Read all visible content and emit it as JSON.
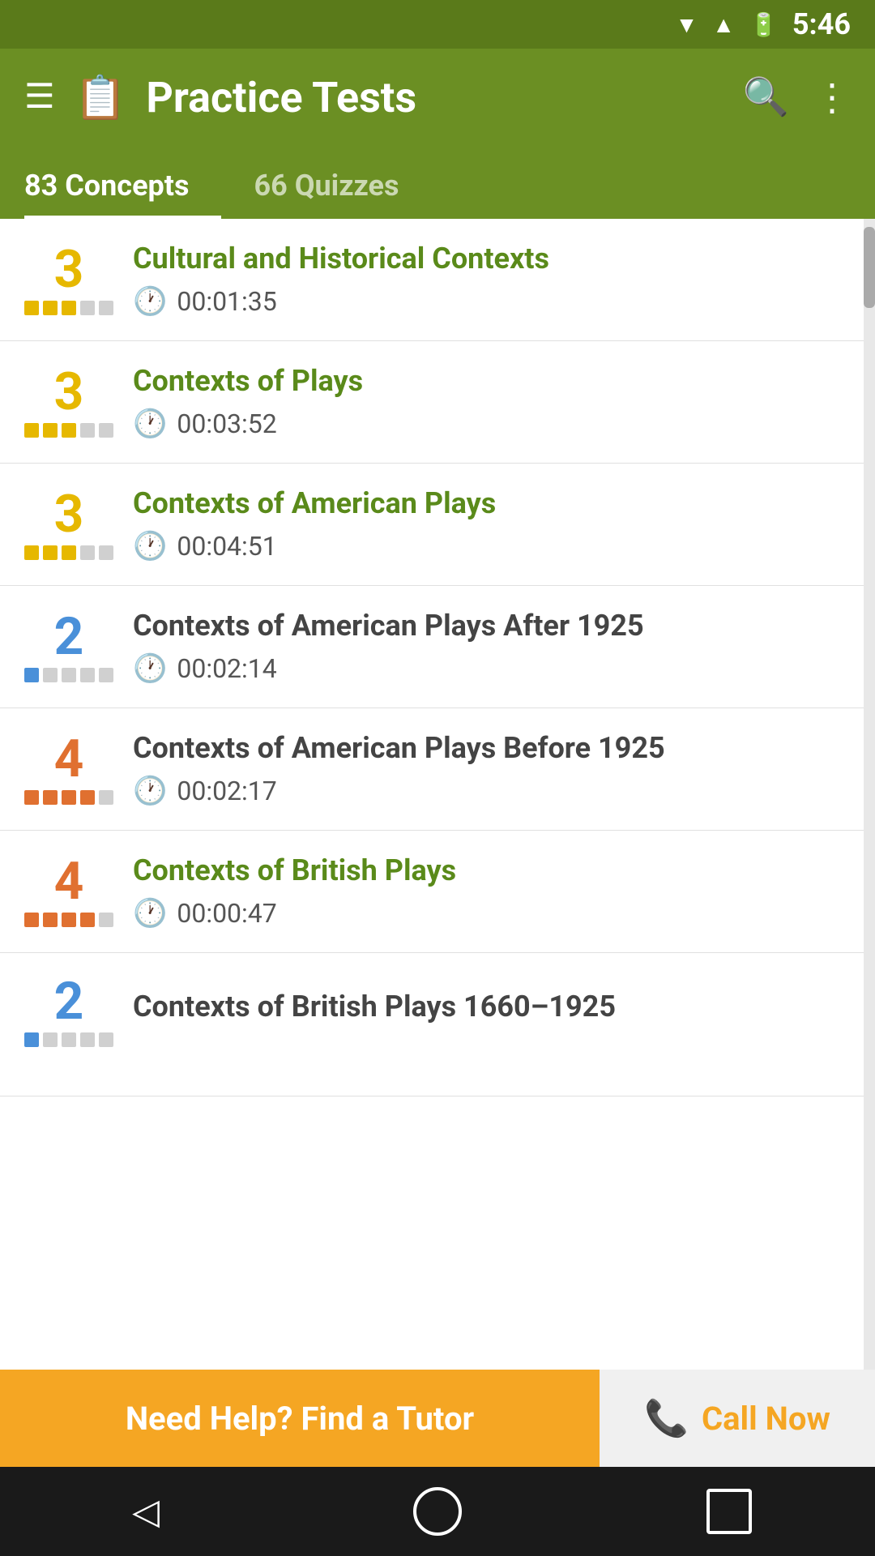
{
  "statusBar": {
    "time": "5:46"
  },
  "appBar": {
    "title": "Practice Tests",
    "iconAlt": "practice-tests-icon"
  },
  "tabs": [
    {
      "label": "83 Concepts",
      "active": true
    },
    {
      "label": "66 Quizzes",
      "active": false
    }
  ],
  "listItems": [
    {
      "score": "3",
      "scoreColor": "yellow",
      "bars": [
        "filled",
        "filled",
        "filled",
        "empty",
        "empty"
      ],
      "title": "Cultural and Historical Contexts",
      "titleStyle": "green",
      "time": "00:01:35"
    },
    {
      "score": "3",
      "scoreColor": "yellow",
      "bars": [
        "filled",
        "filled",
        "filled",
        "empty",
        "empty"
      ],
      "title": "Contexts of Plays",
      "titleStyle": "green",
      "time": "00:03:52"
    },
    {
      "score": "3",
      "scoreColor": "yellow",
      "bars": [
        "filled",
        "filled",
        "filled",
        "empty",
        "empty"
      ],
      "title": "Contexts of American Plays",
      "titleStyle": "green",
      "time": "00:04:51"
    },
    {
      "score": "2",
      "scoreColor": "blue",
      "bars": [
        "filled",
        "empty",
        "empty",
        "empty",
        "empty"
      ],
      "title": "Contexts of American Plays After 1925",
      "titleStyle": "dark",
      "time": "00:02:14"
    },
    {
      "score": "4",
      "scoreColor": "orange",
      "bars": [
        "filled",
        "filled",
        "filled",
        "filled",
        "empty"
      ],
      "title": "Contexts of American Plays Before 1925",
      "titleStyle": "dark",
      "time": "00:02:17"
    },
    {
      "score": "4",
      "scoreColor": "orange",
      "bars": [
        "filled",
        "filled",
        "filled",
        "filled",
        "empty"
      ],
      "title": "Contexts of British Plays",
      "titleStyle": "green",
      "time": "00:00:47"
    },
    {
      "score": "2",
      "scoreColor": "blue",
      "bars": [
        "filled",
        "empty",
        "empty",
        "empty",
        "empty"
      ],
      "title": "Contexts of British Plays 1660–1925",
      "titleStyle": "dark",
      "time": ""
    }
  ],
  "bottomBanner": {
    "findTutorLabel": "Need Help? Find a Tutor",
    "callNowLabel": "Call Now"
  }
}
